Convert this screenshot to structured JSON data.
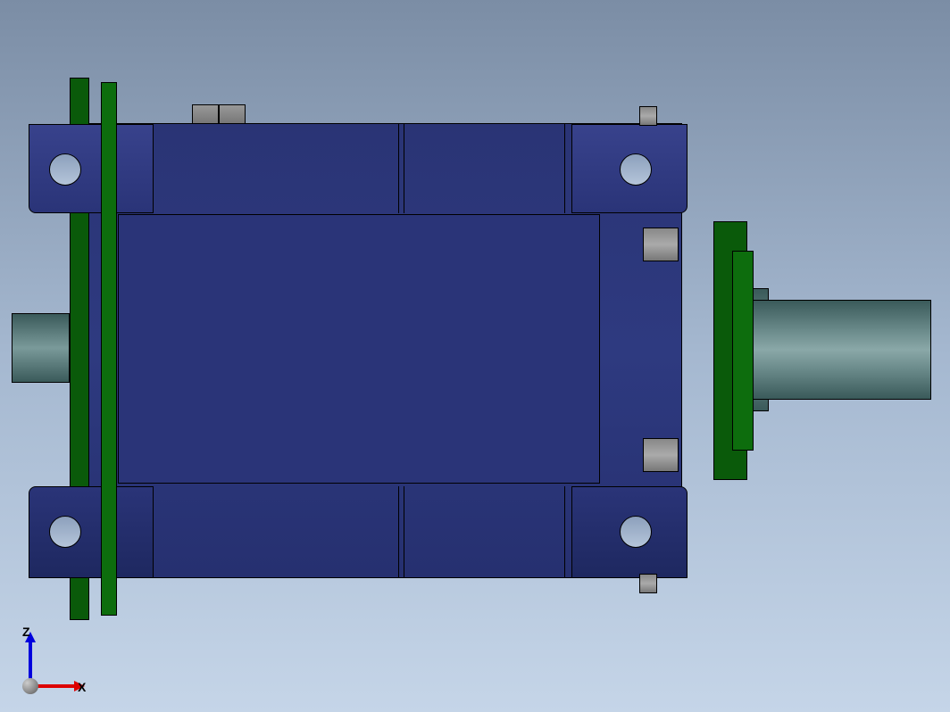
{
  "axes": {
    "z_label": "Z",
    "x_label": "X"
  },
  "colors": {
    "body": "#2a3478",
    "plate": "#0a5a0a",
    "shaft": "#6a8a8a",
    "background_top": "#7b8da5",
    "background_bottom": "#c5d5e8"
  }
}
